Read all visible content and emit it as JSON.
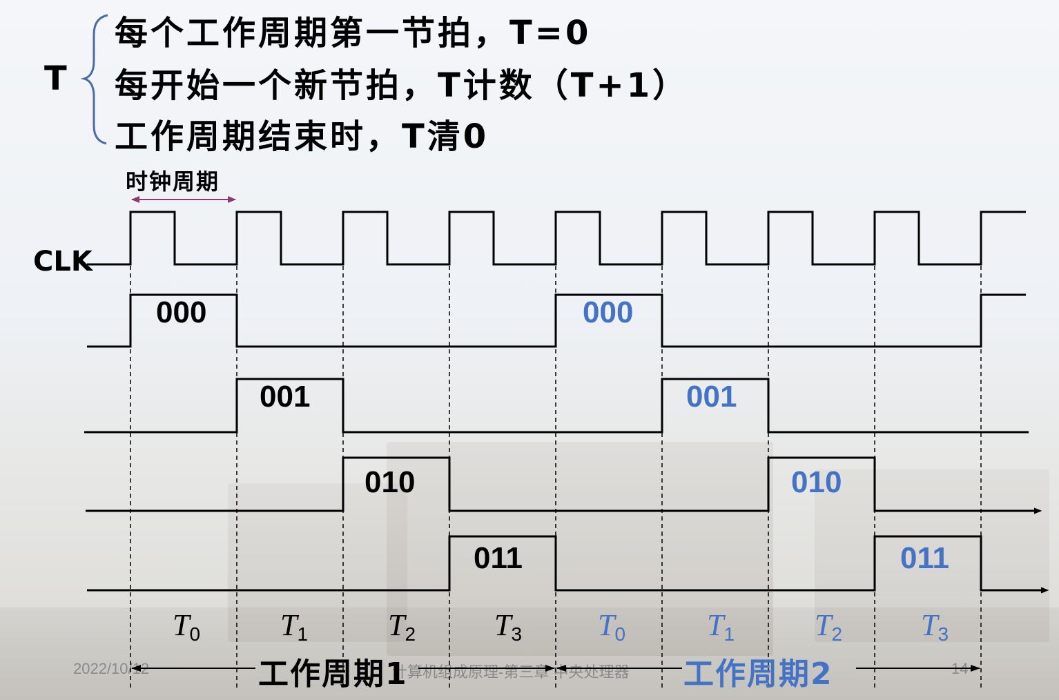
{
  "header": {
    "t_letter": "T",
    "rules": [
      "每个工作周期第一节拍，T=0",
      "每开始一个新节拍，T计数（T+1）",
      "工作周期结束时，T清0"
    ]
  },
  "clock": {
    "label": "CLK",
    "period_label": "时钟周期"
  },
  "states": {
    "cycle1": [
      "000",
      "001",
      "010",
      "011"
    ],
    "cycle2": [
      "000",
      "001",
      "010",
      "011"
    ]
  },
  "beats": {
    "cycle1": [
      {
        "letter": "T",
        "sub": "0"
      },
      {
        "letter": "T",
        "sub": "1"
      },
      {
        "letter": "T",
        "sub": "2"
      },
      {
        "letter": "T",
        "sub": "3"
      }
    ],
    "cycle2": [
      {
        "letter": "T",
        "sub": "0"
      },
      {
        "letter": "T",
        "sub": "1"
      },
      {
        "letter": "T",
        "sub": "2"
      },
      {
        "letter": "T",
        "sub": "3"
      }
    ]
  },
  "cycles": {
    "cycle1_label": "工作周期1",
    "cycle2_label": "工作周期2"
  },
  "footer": {
    "date": "2022/10/12",
    "course": "计算机组成原理-第三章 中央处理器",
    "page": "14"
  },
  "colors": {
    "cycle1": "#000000",
    "cycle2": "#4472c4",
    "period_arrow": "#8b3a6b"
  }
}
